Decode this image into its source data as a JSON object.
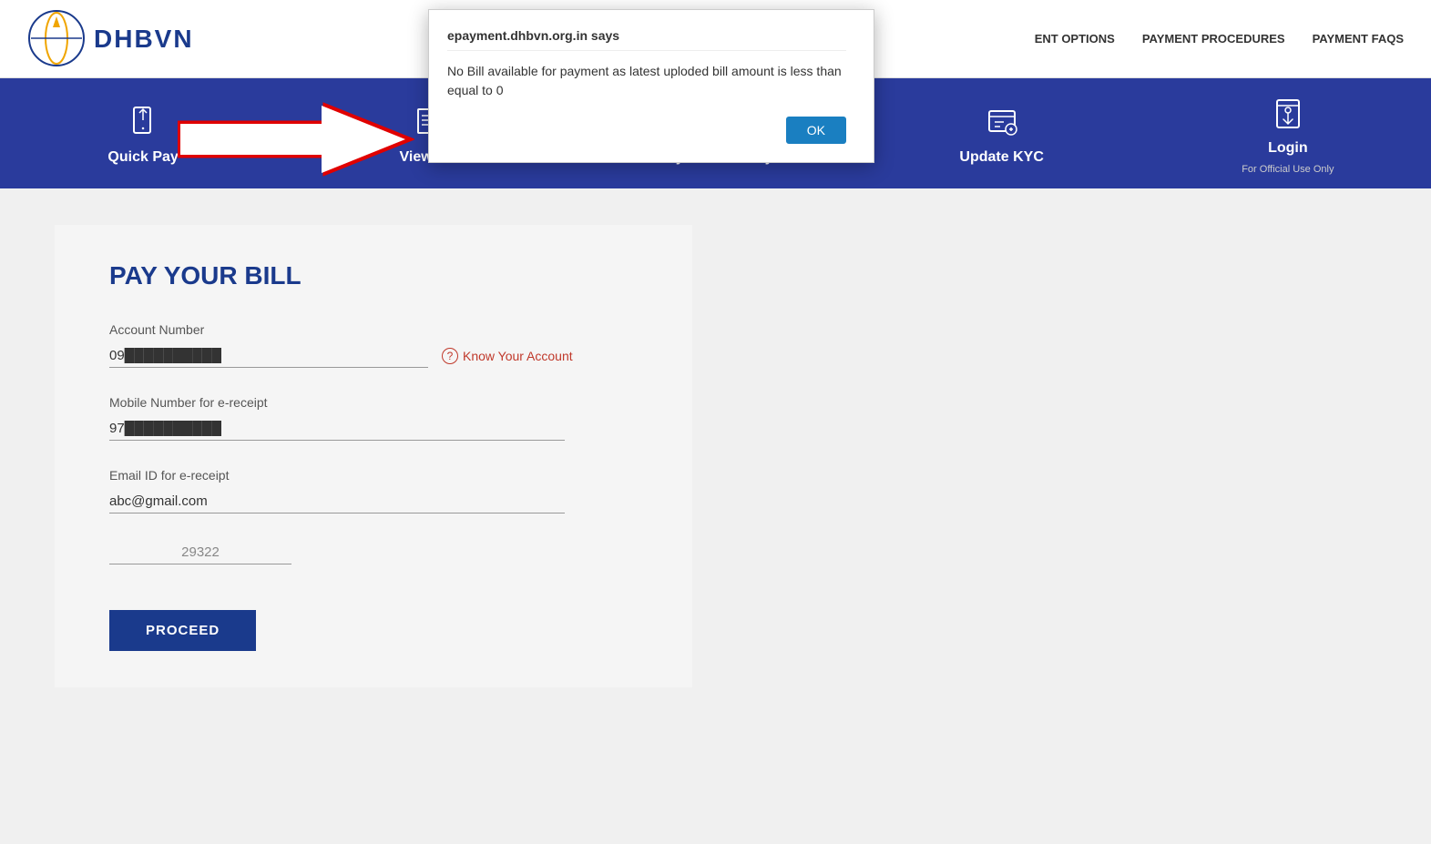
{
  "header": {
    "logo_text": "DHBVN",
    "nav_items": [
      {
        "label": "ENT OPTIONS",
        "id": "nav-payment-options"
      },
      {
        "label": "PAYMENT PROCEDURES",
        "id": "nav-payment-procedures"
      },
      {
        "label": "PAYMENT FAQS",
        "id": "nav-payment-faqs"
      }
    ]
  },
  "blue_bar": {
    "items": [
      {
        "id": "quick-pay",
        "label": "Quick Pay",
        "sublabel": ""
      },
      {
        "id": "view-bill",
        "label": "View Bill",
        "sublabel": ""
      },
      {
        "id": "payment-history",
        "label": "Payment History",
        "sublabel": ""
      },
      {
        "id": "update-kyc",
        "label": "Update KYC",
        "sublabel": ""
      },
      {
        "id": "login",
        "label": "Login",
        "sublabel": "For Official Use Only"
      }
    ]
  },
  "form": {
    "title": "PAY YOUR BILL",
    "account_number_label": "Account Number",
    "account_number_value": "09██████████",
    "know_account_label": "Know Your Account",
    "mobile_label": "Mobile Number for e-receipt",
    "mobile_value": "97██████████",
    "email_label": "Email ID for e-receipt",
    "email_value": "abc@gmail.com",
    "captcha_value": "29322",
    "proceed_label": "PROCEED"
  },
  "dialog": {
    "title": "epayment.dhbvn.org.in says",
    "message": "No Bill available for payment as latest uploded bill amount is less than equal to 0",
    "ok_label": "OK"
  },
  "icons": {
    "quick_pay": "📱",
    "view_bill": "📄",
    "payment_history": "🧾",
    "update_kyc": "📋",
    "login": "👆"
  }
}
